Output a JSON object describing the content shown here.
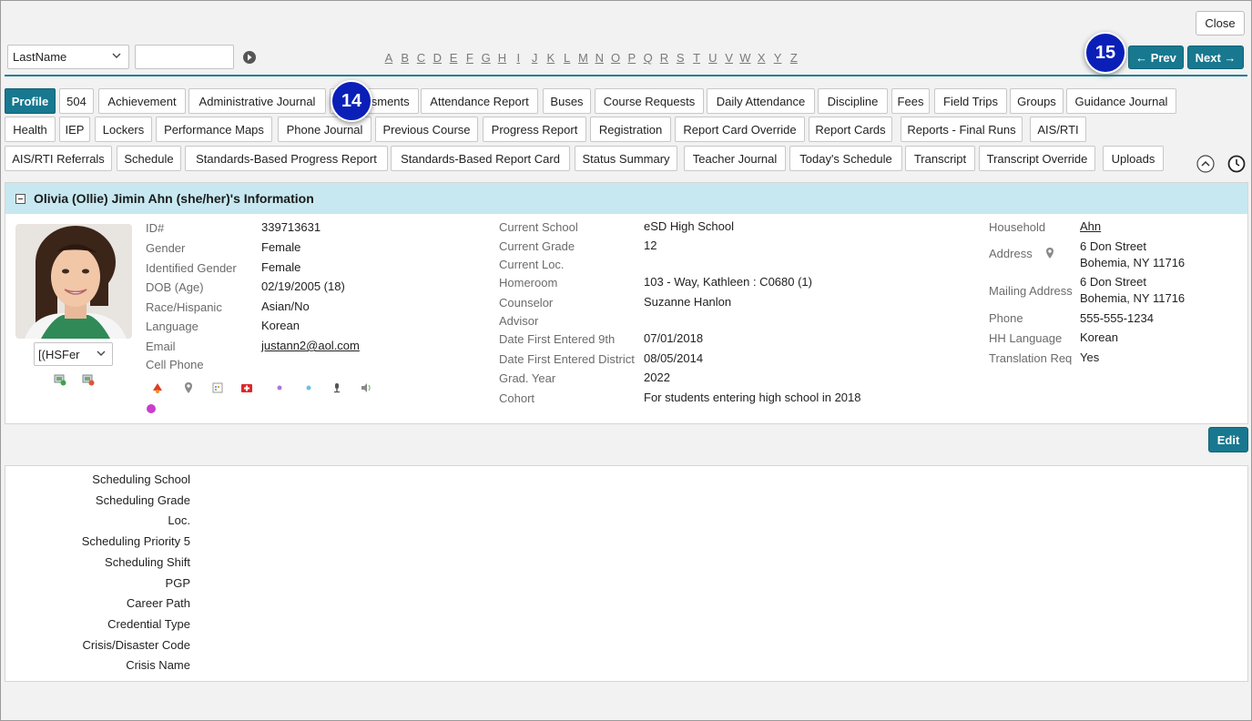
{
  "toolbar": {
    "close_label": "Close",
    "search_select": "LastName",
    "search_value": "",
    "alphabet": [
      "A",
      "B",
      "C",
      "D",
      "E",
      "F",
      "G",
      "H",
      "I",
      "J",
      "K",
      "L",
      "M",
      "N",
      "O",
      "P",
      "Q",
      "R",
      "S",
      "T",
      "U",
      "V",
      "W",
      "X",
      "Y",
      "Z"
    ],
    "prev_label": "← Prev",
    "next_label": "Next →"
  },
  "callouts": {
    "tabs": "14",
    "nav": "15"
  },
  "tabs": {
    "row1": [
      "Profile",
      "504",
      "Achievement",
      "Administrative Journal",
      "Assessments",
      "Attendance Report",
      "Buses",
      "Course Requests",
      "Daily Attendance",
      "Discipline",
      "Fees",
      "Field Trips",
      "Groups",
      "Guidance Journal"
    ],
    "row2": [
      "Health",
      "IEP",
      "Lockers",
      "Performance Maps",
      "Phone Journal",
      "Previous Course",
      "Progress Report",
      "Registration",
      "Report Card Override",
      "Report Cards",
      "Reports - Final Runs",
      "AIS/RTI"
    ],
    "row3": [
      "AIS/RTI Referrals",
      "Schedule",
      "Standards-Based Progress Report",
      "Standards-Based Report Card",
      "Status Summary",
      "Teacher Journal",
      "Today's Schedule",
      "Transcript",
      "Transcript Override",
      "Uploads"
    ],
    "active": "Profile"
  },
  "student": {
    "header": "Olivia (Ollie) Jimin Ahn (she/her)'s Information",
    "photo_select": "[(HSFer",
    "col1": [
      {
        "label": "ID#",
        "value": "339713631"
      },
      {
        "label": "Gender",
        "value": "Female"
      },
      {
        "label": "Identified Gender",
        "value": "Female"
      },
      {
        "label": "DOB (Age)",
        "value": "02/19/2005 (18)"
      },
      {
        "label": "Race/Hispanic",
        "value": "Asian/No"
      },
      {
        "label": "Language",
        "value": "Korean"
      },
      {
        "label": "Email",
        "value": "justann2@aol.com"
      },
      {
        "label": "Cell Phone",
        "value": ""
      }
    ],
    "col2": [
      {
        "label": "Current School",
        "value": "eSD High School"
      },
      {
        "label": "Current Grade",
        "value": "12"
      },
      {
        "label": "Current Loc.",
        "value": ""
      },
      {
        "label": "Homeroom",
        "value": "103 - Way, Kathleen : C0680 (1)"
      },
      {
        "label": "Counselor",
        "value": "Suzanne Hanlon"
      },
      {
        "label": "Advisor",
        "value": ""
      },
      {
        "label": "Date First Entered 9th",
        "value": "07/01/2018"
      },
      {
        "label": "Date First Entered District",
        "value": "08/05/2014"
      },
      {
        "label": "Grad. Year",
        "value": "2022"
      },
      {
        "label": "Cohort",
        "value": "For students entering high school in 2018"
      }
    ],
    "col3": {
      "household_label": "Household",
      "household_value": "Ahn",
      "address_label": "Address",
      "address_line1": "6 Don Street",
      "address_line2": "Bohemia, NY 11716",
      "mailing_label": "Mailing Address",
      "mailing_line1": "6 Don Street",
      "mailing_line2": "Bohemia, NY 11716",
      "phone_label": "Phone",
      "phone_value": "555-555-1234",
      "hh_lang_label": "HH Language",
      "hh_lang_value": "Korean",
      "translation_label": "Translation Req",
      "translation_value": "Yes"
    },
    "edit_label": "Edit"
  },
  "scheduling": {
    "labels": [
      "Scheduling School",
      "Scheduling Grade",
      "Loc.",
      "Scheduling Priority 5",
      "Scheduling Shift",
      "PGP",
      "Career Path",
      "Credential Type",
      "Crisis/Disaster Code",
      "Crisis Name"
    ]
  },
  "colors": {
    "accent": "#17788f",
    "header_bg": "#c7e8f0",
    "callout": "#0a1fb8"
  }
}
